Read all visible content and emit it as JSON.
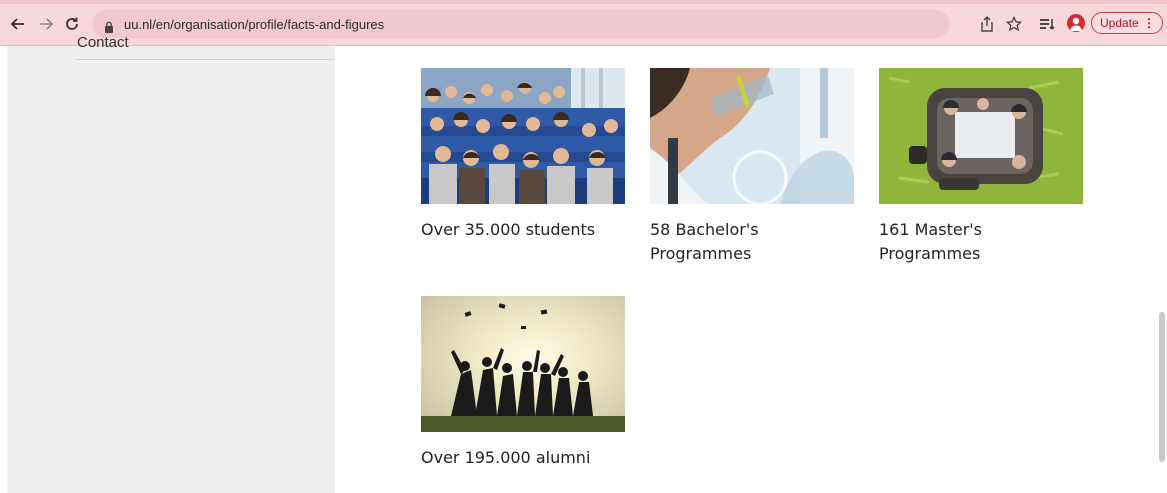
{
  "browser": {
    "url": "uu.nl/en/organisation/profile/facts-and-figures",
    "update_label": "Update",
    "menu_glyph": "⋮",
    "icons": [
      "back-arrow-icon",
      "forward-arrow-icon",
      "reload-icon",
      "lock-icon",
      "share-icon",
      "star-icon",
      "reading-list-icon",
      "profile-avatar-icon",
      "kebab-menu-icon"
    ],
    "accent_color": "#f7d7dc"
  },
  "sidebar": {
    "contact_label": "Contact"
  },
  "facts": [
    {
      "caption": "Over 35.000 students",
      "image": "lecture-hall-photo"
    },
    {
      "caption": "58 Bachelor's Programmes",
      "image": "lab-researcher-photo"
    },
    {
      "caption": "161 Master's Programmes",
      "image": "study-group-photo"
    },
    {
      "caption": "Over 195.000 alumni",
      "image": "graduation-photo"
    }
  ]
}
